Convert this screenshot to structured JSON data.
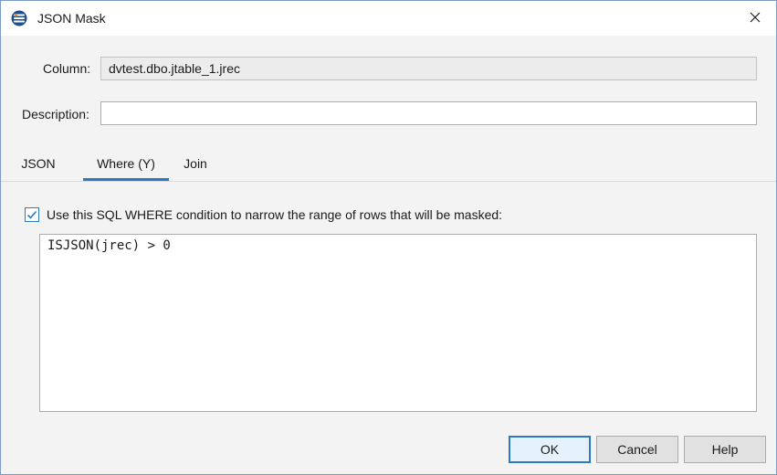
{
  "window": {
    "title": "JSON Mask",
    "icon": "database-icon",
    "close_icon": "close-icon"
  },
  "form": {
    "column_label": "Column:",
    "column_value": "dvtest.dbo.jtable_1.jrec",
    "description_label": "Description:",
    "description_value": ""
  },
  "tabs": [
    {
      "label": "JSON",
      "active": false
    },
    {
      "label": "Where (Y)",
      "active": true
    },
    {
      "label": "Join",
      "active": false
    }
  ],
  "where": {
    "checkbox_checked": true,
    "checkbox_label": "Use this SQL WHERE condition to narrow the range of rows that will be masked:",
    "sql": "ISJSON(jrec) > 0"
  },
  "buttons": {
    "ok": "OK",
    "cancel": "Cancel",
    "help": "Help"
  },
  "colors": {
    "accent": "#2b78c5",
    "dialog_bg": "#f3f3f3",
    "readonly_bg": "#ececec"
  }
}
